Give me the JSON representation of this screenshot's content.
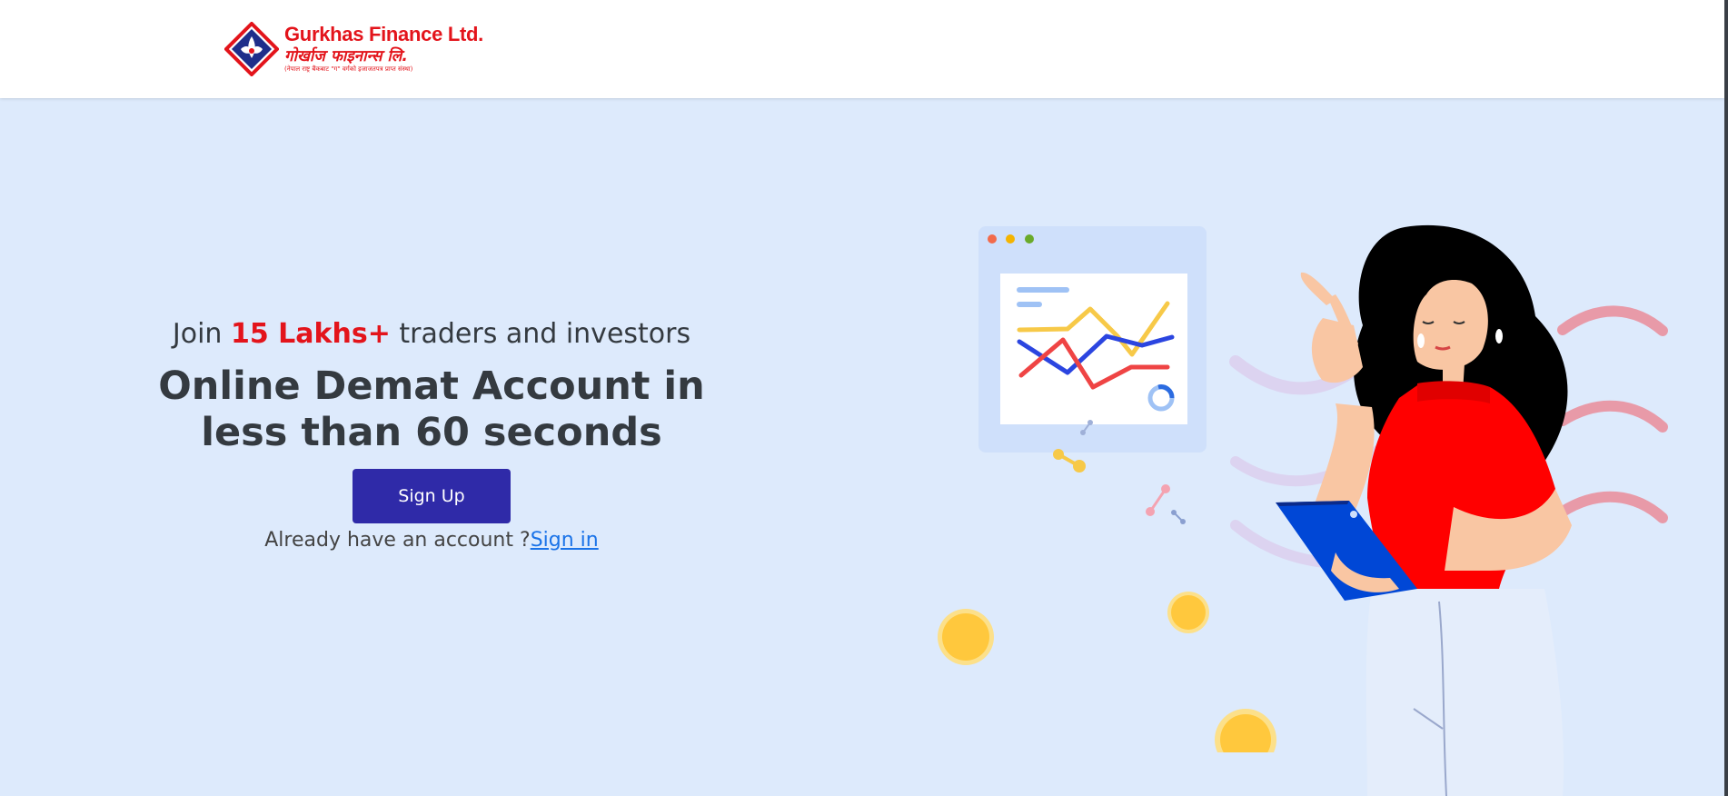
{
  "header": {
    "logo": {
      "name_en": "Gurkhas Finance Ltd.",
      "name_np": "गोर्खाज फाइनान्स लि.",
      "tagline": "(नेपाल राष्ट्र बैंकबाट \"ग\" वर्गको इजाजतपत्र प्राप्त संस्था)"
    }
  },
  "hero": {
    "join_prefix": "Join ",
    "join_highlight": "15 Lakhs+",
    "join_suffix": " traders and investors",
    "headline_line1": "Online Demat Account in",
    "headline_line2": "less than 60 seconds",
    "signup_label": "Sign Up",
    "signin_prompt": "Already have an account ?",
    "signin_link": "Sign in"
  },
  "colors": {
    "brand_red": "#e3141b",
    "button_blue": "#2f2aa8",
    "hero_bg": "#ddeafc",
    "link_blue": "#1a73e8"
  }
}
